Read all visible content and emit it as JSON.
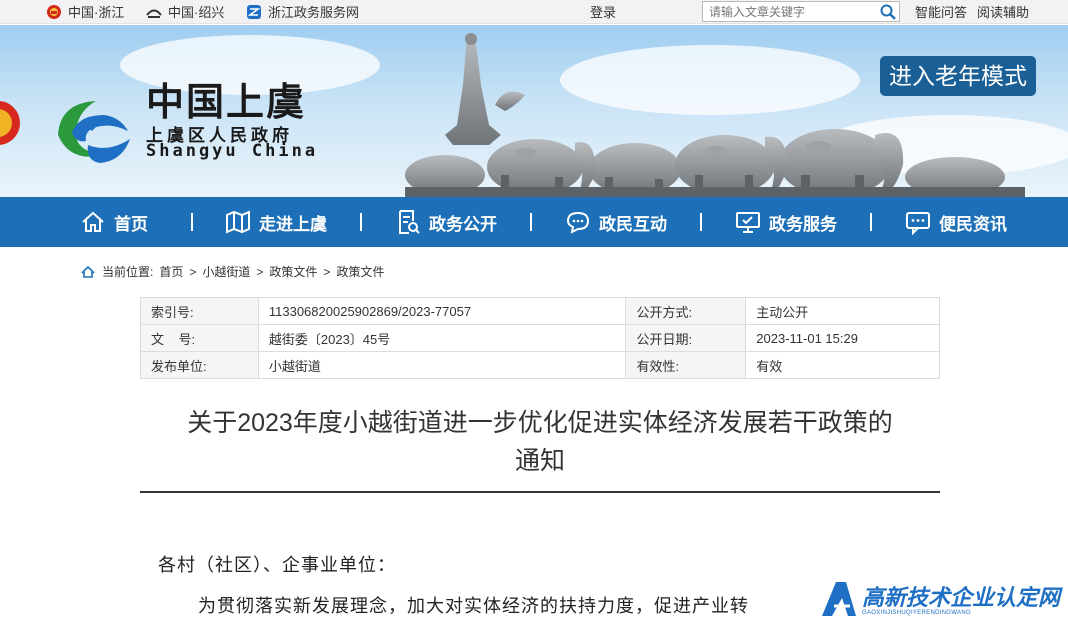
{
  "topbar": {
    "links": [
      {
        "label": "中国·浙江",
        "icon": "national-emblem-icon"
      },
      {
        "label": "中国·绍兴",
        "icon": "shaoxing-emblem-icon"
      },
      {
        "label": "浙江政务服务网",
        "icon": "zjzwfw-logo-icon"
      }
    ],
    "login": "登录",
    "search_placeholder": "请输入文章关键字",
    "util": [
      "智能问答",
      "阅读辅助"
    ]
  },
  "header": {
    "brand_cn": "中国上虞",
    "brand_sub": "上虞区人民政府",
    "brand_en": "Shangyu China",
    "elder_mode": "进入老年模式",
    "accent": "#1d70b7"
  },
  "nav": {
    "items": [
      {
        "label": "首页",
        "icon": "home-icon"
      },
      {
        "label": "走进上虞",
        "icon": "map-icon"
      },
      {
        "label": "政务公开",
        "icon": "document-search-icon"
      },
      {
        "label": "政民互动",
        "icon": "chat-icon"
      },
      {
        "label": "政务服务",
        "icon": "monitor-icon"
      },
      {
        "label": "便民资讯",
        "icon": "message-icon"
      }
    ]
  },
  "breadcrumb": {
    "prefix": "当前位置:",
    "items": [
      "首页",
      "小越街道",
      "政策文件",
      "政策文件"
    ],
    "sep": ">"
  },
  "info": {
    "rows": [
      {
        "k1": "索引号:",
        "v1": "113306820025902869/2023-77057",
        "k2": "公开方式:",
        "v2": "主动公开"
      },
      {
        "k1": "文    号:",
        "v1": "越街委〔2023〕45号",
        "k2": "公开日期:",
        "v2": "2023-11-01 15:29"
      },
      {
        "k1": "发布单位:",
        "v1": "小越街道",
        "k2": "有效性:",
        "v2": "有效"
      }
    ]
  },
  "doc": {
    "title_line1": "关于2023年度小越街道进一步优化促进实体经济发展若干政策的",
    "title_line2": "通知",
    "p1": "各村（社区）、企事业单位：",
    "p2": "为贯彻落实新发展理念，加大对实体经济的扶持力度，促进产业转"
  },
  "watermark": {
    "text": "高新技术企业认定网",
    "small": "GAOXINJISHUQIYERENDINGWANG"
  }
}
